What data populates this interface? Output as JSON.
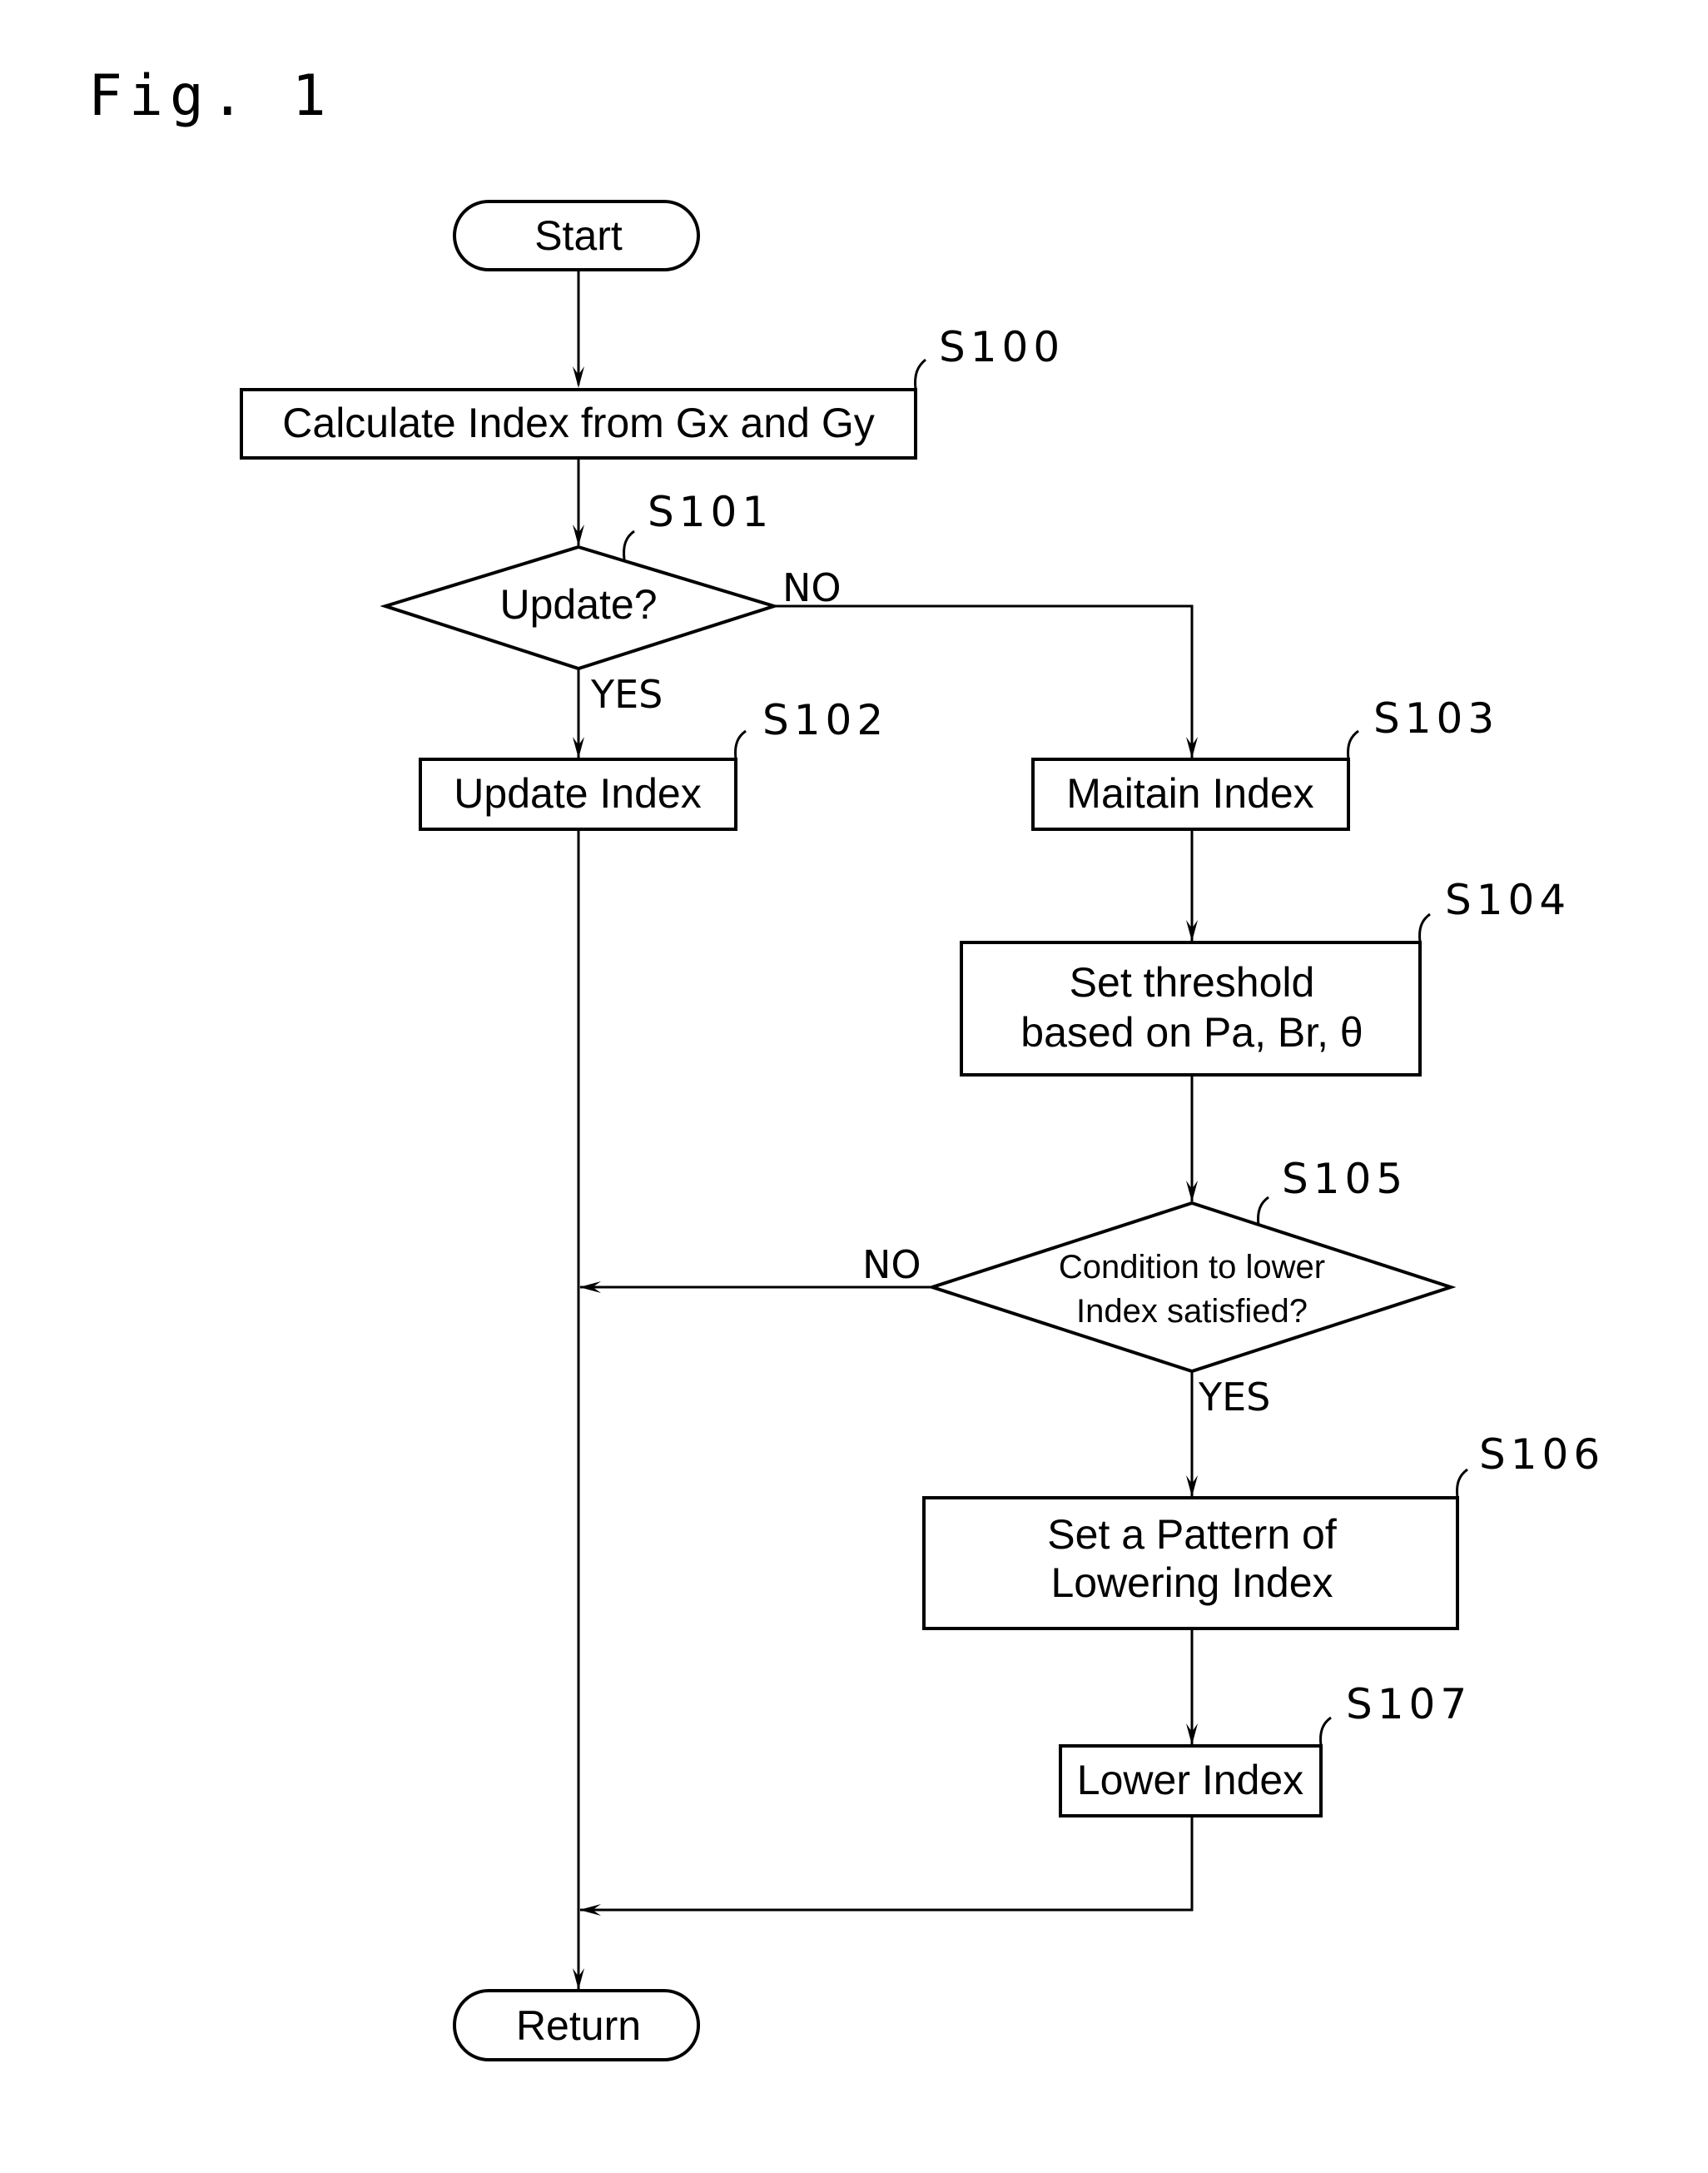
{
  "figure": {
    "title": "Fig. 1"
  },
  "nodes": {
    "start": {
      "type": "terminal",
      "text": "Start"
    },
    "s100": {
      "type": "process",
      "step": "S100",
      "text": "Calculate Index from Gx and Gy"
    },
    "s101": {
      "type": "decision",
      "step": "S101",
      "text": "Update?"
    },
    "s102": {
      "type": "process",
      "step": "S102",
      "text": "Update Index"
    },
    "s103": {
      "type": "process",
      "step": "S103",
      "text": "Maitain Index"
    },
    "s104": {
      "type": "process",
      "step": "S104",
      "lines": [
        "Set threshold",
        "based on Pa, Br, θ"
      ]
    },
    "s105": {
      "type": "decision",
      "step": "S105",
      "lines": [
        "Condition to lower",
        "Index satisfied?"
      ]
    },
    "s106": {
      "type": "process",
      "step": "S106",
      "lines": [
        "Set a Pattern of",
        "Lowering Index"
      ]
    },
    "s107": {
      "type": "process",
      "step": "S107",
      "text": "Lower Index"
    },
    "return": {
      "type": "terminal",
      "text": "Return"
    }
  },
  "edges": {
    "s101_yes": "YES",
    "s101_no": "NO",
    "s105_yes": "YES",
    "s105_no": "NO"
  }
}
